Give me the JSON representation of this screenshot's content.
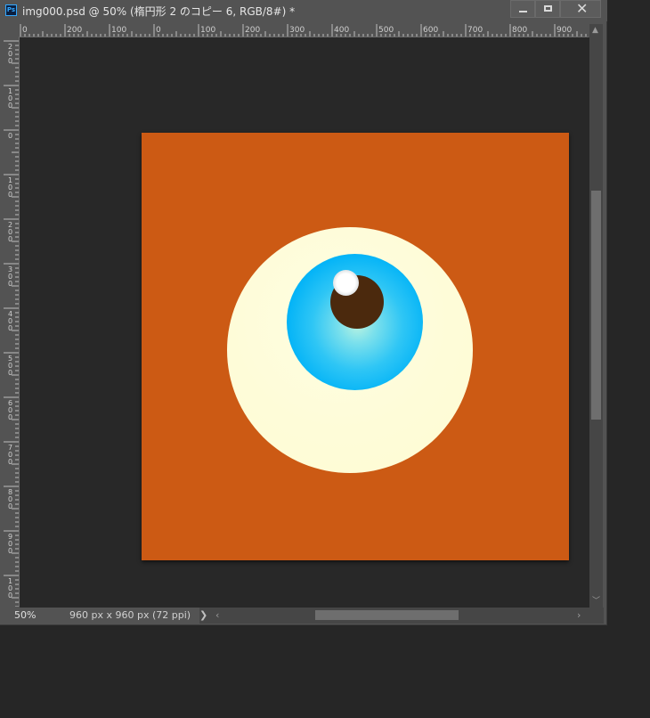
{
  "window": {
    "title": "img000.psd @ 50% (楕円形 2 のコピー 6, RGB/8#) *",
    "app_icon": "Ps",
    "buttons": {
      "minimize": "minimize-icon",
      "maximize": "maximize-icon",
      "close": "✕"
    }
  },
  "rulers": {
    "top_labels": [
      "0",
      "200",
      "100",
      "0",
      "100",
      "200",
      "300",
      "400",
      "500",
      "600",
      "700",
      "800",
      "900"
    ],
    "left_labels": [
      "2\n0\n0",
      "1\n0\n0",
      "0",
      "1\n0\n0",
      "2\n0\n0",
      "3\n0\n0",
      "4\n0\n0",
      "5\n0\n0",
      "6\n0\n0",
      "7\n0\n0",
      "8\n0\n0",
      "9\n0\n0",
      "1\n0\n0"
    ]
  },
  "canvas": {
    "document_color": "#cc5a14",
    "eyeball_color": "#fffcd4",
    "iris_color": "#04b1f8",
    "pupil_color": "#4b290d"
  },
  "status": {
    "zoom": "50%",
    "doc_info": "960 px x 960 px (72 ppi)",
    "info_arrow": "❯"
  },
  "scrollbars": {
    "up": "▲",
    "down": "﹀",
    "left": "‹",
    "right": "›"
  }
}
